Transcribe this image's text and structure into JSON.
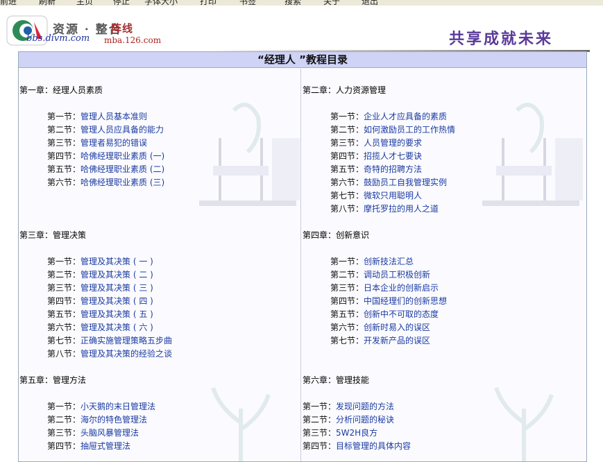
{
  "menubar": {
    "items": [
      "前进",
      "刷新",
      "主页",
      "停止",
      "字体大小",
      "打印",
      "书签",
      "搜索",
      "关于",
      "退出"
    ]
  },
  "header": {
    "brand_cn": "资源 · 整合",
    "brand_red": "阵线",
    "site_url": "bbs.divm.com",
    "site_url2": "mba.126.com",
    "slogan": "共享成就未来"
  },
  "page_title": "“经理人 ”教程目录",
  "chapters": [
    {
      "title": "第一章：经理人员素质",
      "sections": [
        {
          "no": "第一节：",
          "title": "管理人员基本准则"
        },
        {
          "no": "第二节：",
          "title": "管理人员应具备的能力"
        },
        {
          "no": "第三节：",
          "title": "管理者易犯的错误"
        },
        {
          "no": "第四节：",
          "title": "哈佛经理职业素质 (一)"
        },
        {
          "no": "第五节：",
          "title": "哈佛经理职业素质 (二)"
        },
        {
          "no": "第六节：",
          "title": "哈佛经理职业素质 (三)"
        }
      ]
    },
    {
      "title": "第二章：人力资源管理",
      "sections": [
        {
          "no": "第一节：",
          "title": "企业人才应具备的素质"
        },
        {
          "no": "第二节：",
          "title": "如何激励员工的工作热情"
        },
        {
          "no": "第三节：",
          "title": "人员管理的要求"
        },
        {
          "no": "第四节：",
          "title": "招揽人才七要诀"
        },
        {
          "no": "第五节：",
          "title": "奇特的招聘方法"
        },
        {
          "no": "第六节：",
          "title": "鼓励员工自我管理实例"
        },
        {
          "no": "第七节：",
          "title": "微软只用聪明人"
        },
        {
          "no": "第八节：",
          "title": "摩托罗拉的用人之道"
        }
      ]
    },
    {
      "title": "第三章：管理决策",
      "sections": [
        {
          "no": "第一节：",
          "title": "管理及其决策 ( 一 )"
        },
        {
          "no": "第二节：",
          "title": "管理及其决策 ( 二 )"
        },
        {
          "no": "第三节：",
          "title": "管理及其决策 ( 三 )"
        },
        {
          "no": "第四节：",
          "title": "管理及其决策 ( 四 )"
        },
        {
          "no": "第五节：",
          "title": "管理及其决策 ( 五 )"
        },
        {
          "no": "第六节：",
          "title": "管理及其决策 ( 六 )"
        },
        {
          "no": "第七节：",
          "title": "正确实施管理策略五步曲"
        },
        {
          "no": "第八节：",
          "title": "管理及其决策的经验之谈"
        }
      ]
    },
    {
      "title": "第四章：创新意识",
      "sections": [
        {
          "no": "第一节：",
          "title": "创新技法汇总"
        },
        {
          "no": "第二节：",
          "title": "调动员工积极创新"
        },
        {
          "no": "第三节：",
          "title": "日本企业的创新启示"
        },
        {
          "no": "第四节：",
          "title": "中国经理们的创新思想"
        },
        {
          "no": "第五节：",
          "title": "创新中不可取的态度"
        },
        {
          "no": "第六节：",
          "title": "创新时易入的误区"
        },
        {
          "no": "第七节：",
          "title": "开发新产品的误区"
        }
      ]
    },
    {
      "title": "第五章：管理方法",
      "sections": [
        {
          "no": "第一节：",
          "title": "小天鹅的末日管理法"
        },
        {
          "no": "第二节：",
          "title": "海尔的特色管理法"
        },
        {
          "no": "第三节：",
          "title": "头脑风暴管理法"
        },
        {
          "no": "第四节：",
          "title": "抽屉式管理法"
        }
      ]
    },
    {
      "title": "第六章：管理技能",
      "sections": [
        {
          "no": "第一节：",
          "title": "发现问题的方法"
        },
        {
          "no": "第二节：",
          "title": "分析问题的秘诀"
        },
        {
          "no": "第三节：",
          "title": "5W2H良方"
        },
        {
          "no": "第四节：",
          "title": "目标管理的具体内容"
        }
      ]
    }
  ]
}
